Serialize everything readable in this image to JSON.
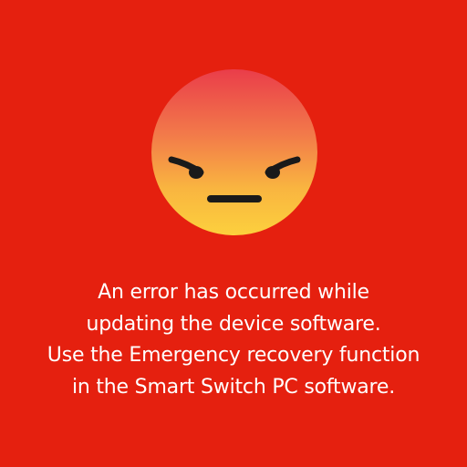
{
  "screen": {
    "background_color": "#e5200f",
    "icon": "angry-face-icon",
    "icon_colors": {
      "top": "#ea3f4a",
      "bottom": "#fbcc3e",
      "features": "#1a1a1a"
    }
  },
  "error": {
    "lines": [
      "An error has occurred while",
      "updating the device software.",
      "Use the Emergency recovery function",
      "in the Smart Switch PC software."
    ]
  }
}
